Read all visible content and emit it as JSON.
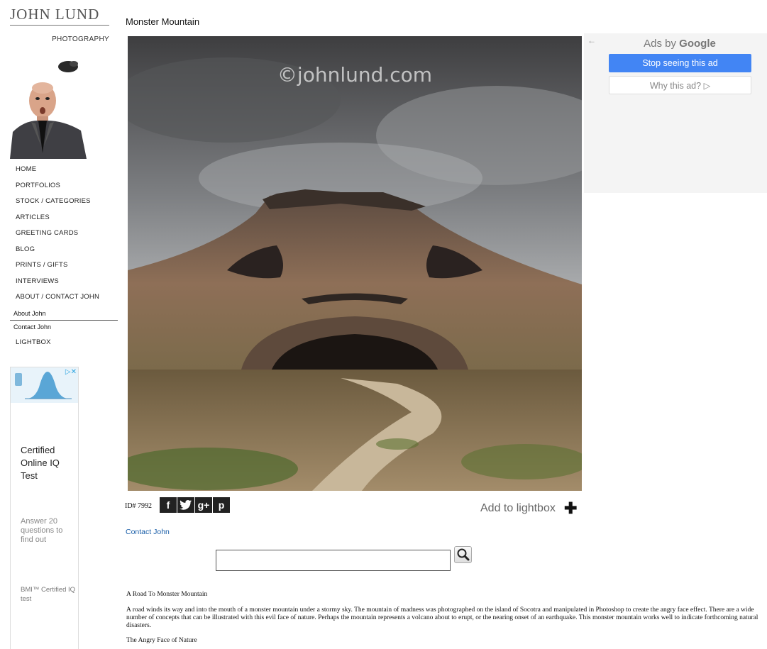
{
  "brand": {
    "name": "JOHN LUND",
    "sub": "PHOTOGRAPHY"
  },
  "nav": {
    "items": [
      "HOME",
      "PORTFOLIOS",
      "STOCK / CATEGORIES",
      "ARTICLES",
      "GREETING CARDS",
      "BLOG",
      "PRINTS / GIFTS",
      "INTERVIEWS",
      "ABOUT / CONTACT JOHN"
    ],
    "sub_items": [
      "About John",
      "Contact John"
    ],
    "last_item": "LIGHTBOX"
  },
  "left_ad": {
    "title": "Certified Online IQ Test",
    "description": "Answer 20 questions to find out",
    "brand": "BMI™ Certified IQ test"
  },
  "page": {
    "title": "Monster Mountain",
    "watermark": "©johnlund.com",
    "image_id": "ID# 7992",
    "add_to_lightbox": "Add to lightbox",
    "contact_link": "Contact John"
  },
  "share": [
    "f",
    "t",
    "g+",
    "p"
  ],
  "search": {
    "value": ""
  },
  "description": {
    "heading": "A Road To Monster Mountain",
    "body": "A road winds its way and into the mouth of a monster mountain under a stormy sky. The mountain of madness was photographed on the island of Socotra and manipulated in Photoshop to create the angry face effect. There are a wide number of concepts that can be illustrated with this evil face of nature. Perhaps the mountain represents a volcano about to erupt, or the nearing onset of an earthquake. This monster mountain works well to indicate forthcoming natural disasters.",
    "footer": "The Angry Face of Nature"
  },
  "right_ad": {
    "ads_by_prefix": "Ads by",
    "ads_by_brand": "Google",
    "stop_label": "Stop seeing this ad",
    "why_label": "Why this ad?"
  },
  "colors": {
    "link": "#1a5ea8",
    "ad_button": "#4285f4"
  }
}
